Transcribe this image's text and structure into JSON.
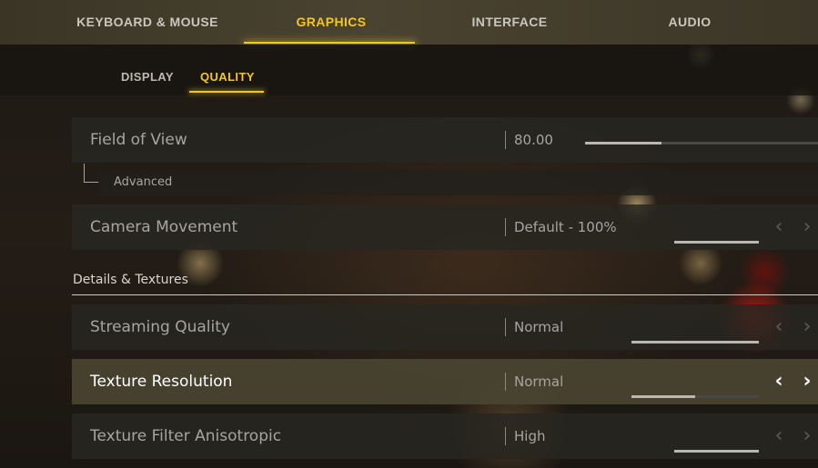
{
  "top_tabs": [
    {
      "label": "KEYBOARD & MOUSE",
      "active": false
    },
    {
      "label": "GRAPHICS",
      "active": true
    },
    {
      "label": "INTERFACE",
      "active": false
    },
    {
      "label": "AUDIO",
      "active": false
    }
  ],
  "sub_tabs": [
    {
      "label": "DISPLAY",
      "active": false
    },
    {
      "label": "QUALITY",
      "active": true
    }
  ],
  "settings": {
    "field_of_view": {
      "label": "Field of View",
      "value": "80.00",
      "slider_fraction": 0.33
    },
    "advanced": {
      "label": "Advanced"
    },
    "camera_movement": {
      "label": "Camera Movement",
      "value": "Default - 100%",
      "level_fraction": 1.0
    }
  },
  "section": {
    "title": "Details & Textures"
  },
  "details": {
    "streaming_quality": {
      "label": "Streaming Quality",
      "value": "Normal",
      "level_fraction": 1.0
    },
    "texture_resolution": {
      "label": "Texture Resolution",
      "value": "Normal",
      "level_fraction": 0.5,
      "focused": true
    },
    "texture_filter_anisotropic": {
      "label": "Texture Filter Anisotropic",
      "value": "High",
      "level_fraction": 1.0
    }
  },
  "icons": {
    "prev": "chevron-left-icon",
    "next": "chevron-right-icon"
  },
  "colors": {
    "accent": "#f3c623",
    "text": "#a8a5a0",
    "focused_text": "#ffffff"
  }
}
